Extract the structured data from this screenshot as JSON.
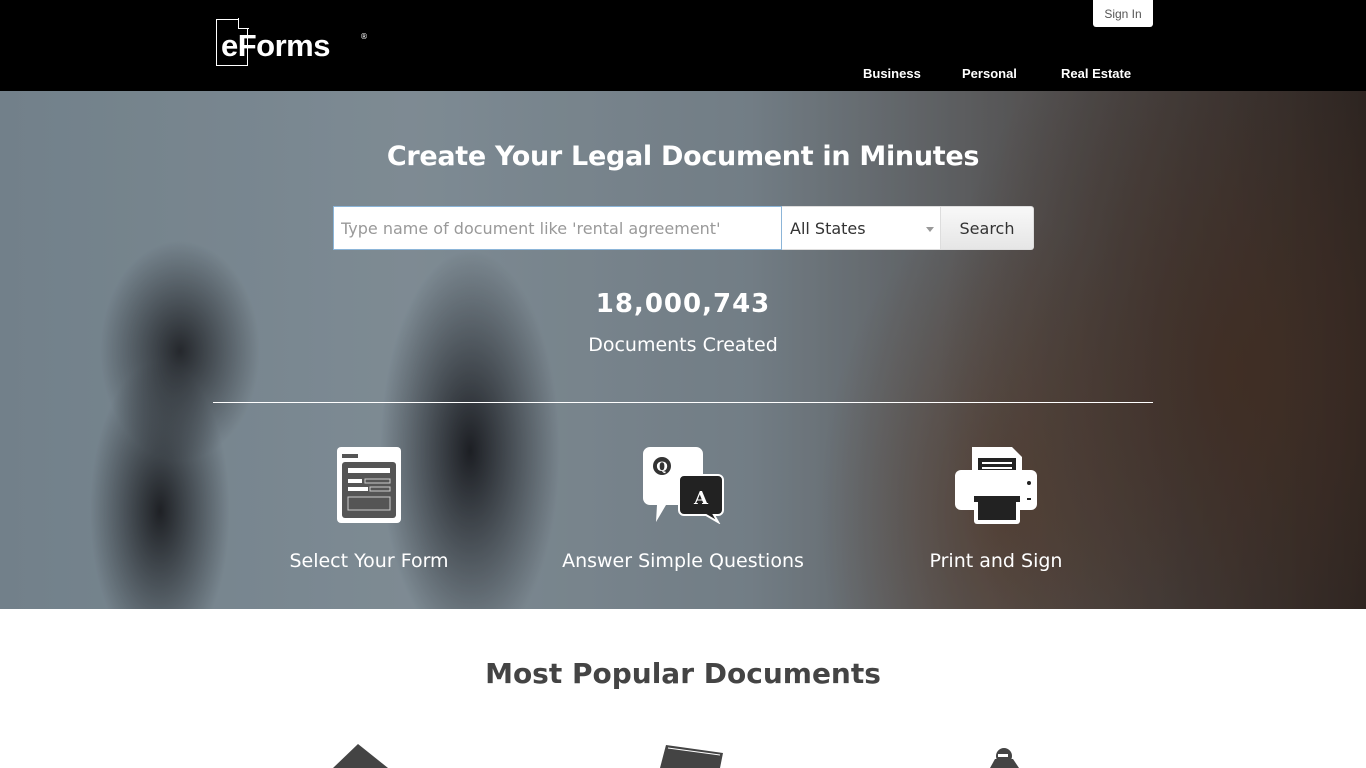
{
  "header": {
    "logo_text": "eForms",
    "logo_mark": "®",
    "signin_label": "Sign In",
    "nav": [
      "Business",
      "Personal",
      "Real Estate"
    ]
  },
  "hero": {
    "title": "Create Your Legal Document in Minutes",
    "search": {
      "placeholder": "Type name of document like 'rental agreement'",
      "value": "",
      "state_selected": "All States",
      "button_label": "Search"
    },
    "counter": {
      "digits": [
        "1",
        "8",
        ",",
        "0",
        "0",
        "0",
        ",",
        "7",
        "4",
        "3"
      ],
      "label": "Documents Created"
    },
    "steps": [
      {
        "icon": "form-icon",
        "label": "Select Your Form"
      },
      {
        "icon": "question-answer-icon",
        "label": "Answer Simple Questions"
      },
      {
        "icon": "printer-icon",
        "label": "Print and Sign"
      }
    ]
  },
  "popular": {
    "title": "Most Popular Documents",
    "icons": [
      "house-icon",
      "lease-document-icon",
      "person-icon"
    ]
  }
}
